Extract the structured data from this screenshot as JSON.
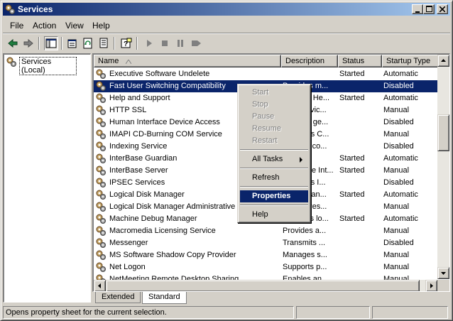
{
  "window": {
    "title": "Services"
  },
  "menu": [
    "File",
    "Action",
    "View",
    "Help"
  ],
  "tree": {
    "root_label": "Services (Local)"
  },
  "columns": {
    "name": "Name",
    "description": "Description",
    "status": "Status",
    "startup": "Startup Type"
  },
  "services": [
    {
      "name": "Executive Software Undelete",
      "description": "",
      "status": "Started",
      "startup": "Automatic",
      "selected": false
    },
    {
      "name": "Fast User Switching Compatibility",
      "description": "Provides m...",
      "status": "",
      "startup": "Disabled",
      "selected": true
    },
    {
      "name": "Help and Support",
      "description": "Enables He...",
      "status": "Started",
      "startup": "Automatic",
      "selected": false
    },
    {
      "name": "HTTP SSL",
      "description": "This servic...",
      "status": "",
      "startup": "Manual",
      "selected": false
    },
    {
      "name": "Human Interface Device Access",
      "description": "Enables ge...",
      "status": "",
      "startup": "Disabled",
      "selected": false
    },
    {
      "name": "IMAPI CD-Burning COM Service",
      "description": "Manages C...",
      "status": "",
      "startup": "Manual",
      "selected": false
    },
    {
      "name": "Indexing Service",
      "description": "Indexes co...",
      "status": "",
      "startup": "Disabled",
      "selected": false
    },
    {
      "name": "InterBase Guardian",
      "description": "",
      "status": "Started",
      "startup": "Automatic",
      "selected": false
    },
    {
      "name": "InterBase Server",
      "description": "InterBase Int...",
      "status": "Started",
      "startup": "Manual",
      "selected": false
    },
    {
      "name": "IPSEC Services",
      "description": "Manages I...",
      "status": "",
      "startup": "Disabled",
      "selected": false
    },
    {
      "name": "Logical Disk Manager",
      "description": "Detects an...",
      "status": "Started",
      "startup": "Automatic",
      "selected": false
    },
    {
      "name": "Logical Disk Manager Administrative Service",
      "description": "Configures...",
      "status": "",
      "startup": "Manual",
      "selected": false
    },
    {
      "name": "Machine Debug Manager",
      "description": "Supports lo...",
      "status": "Started",
      "startup": "Automatic",
      "selected": false
    },
    {
      "name": "Macromedia Licensing Service",
      "description": "Provides a...",
      "status": "",
      "startup": "Manual",
      "selected": false
    },
    {
      "name": "Messenger",
      "description": "Transmits ...",
      "status": "",
      "startup": "Disabled",
      "selected": false
    },
    {
      "name": "MS Software Shadow Copy Provider",
      "description": "Manages s...",
      "status": "",
      "startup": "Manual",
      "selected": false
    },
    {
      "name": "Net Logon",
      "description": "Supports p...",
      "status": "",
      "startup": "Manual",
      "selected": false
    },
    {
      "name": "NetMeeting Remote Desktop Sharing",
      "description": "Enables an...",
      "status": "",
      "startup": "Manual",
      "selected": false
    }
  ],
  "context_menu": {
    "start": "Start",
    "stop": "Stop",
    "pause": "Pause",
    "resume": "Resume",
    "restart": "Restart",
    "all_tasks": "All Tasks",
    "refresh": "Refresh",
    "properties": "Properties",
    "help": "Help"
  },
  "tabs": {
    "extended": "Extended",
    "standard": "Standard"
  },
  "status_bar": {
    "text": "Opens property sheet for the current selection."
  },
  "colors": {
    "selection": "#0a246a",
    "face": "#d4d0c8"
  }
}
